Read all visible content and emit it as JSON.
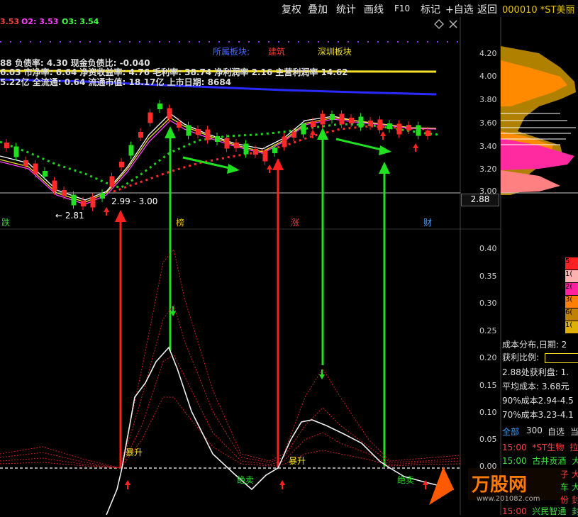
{
  "toolbar": {
    "items": [
      "复权",
      "叠加",
      "统计",
      "画线",
      "F10",
      "标记",
      "+自选",
      "返回"
    ],
    "stock_title": "000010 *ST美丽",
    "icons": [
      "diamond-icon",
      "close-icon"
    ]
  },
  "ma_line": {
    "items": [
      {
        "text": "3.53",
        "color": "#ff4040"
      },
      {
        "text": "O2: 3.53",
        "color": "#ff40ff"
      },
      {
        "text": "O3: 3.54",
        "color": "#40ff40"
      }
    ]
  },
  "block_row": {
    "label": "所属板块:",
    "industry": "建筑",
    "region": "深圳板块"
  },
  "info_lines": [
    {
      "text": "88 负债率: 4.30 现金负债比: -0.040",
      "color": "#ff3a3a"
    },
    {
      "text": "6.03 市净率: 6.64 净资收益率: 4.76 毛利率: 38.74 净利润率 2.16 主营利润率 14.62",
      "color": "#f5e12a"
    },
    {
      "text": "5.22亿 全流通: 0.64 流通市值: 18.17亿 上市日期: 8684",
      "color": "#ff3ae0"
    }
  ],
  "price_axis": [
    "4.20",
    "4.00",
    "3.80",
    "3.60",
    "3.40",
    "3.20",
    "3.00"
  ],
  "price_tag": "2.88",
  "annotations": {
    "low": "← 2.81",
    "range": "2.99 - 3.00"
  },
  "event_tags": [
    {
      "text": "跌",
      "color": "#3cd23c"
    },
    {
      "text": "榜",
      "color": "#e0c200"
    },
    {
      "text": "涨",
      "color": "#ff3030"
    },
    {
      "text": "财",
      "color": "#4aa0ff"
    }
  ],
  "indicator_axis": [
    "0.40",
    "0.35",
    "0.30",
    "0.25",
    "0.20",
    "0.15",
    "0.10",
    "0.05",
    "0.00"
  ],
  "indicator_labels": {
    "rise": "暴升",
    "rise2": "暴升",
    "sell": "绝卖",
    "sell2": "绝卖"
  },
  "side_panel": {
    "title": "成本分布,日期: 2",
    "profit_label": "获利比例:",
    "profit_at": "2.88处获利盘: 1.",
    "avg_cost": "平均成本: 3.68元",
    "cost90": "90%成本2.94-4.5",
    "cost70": "70%成本3.23-4.1",
    "tabs": [
      "全部",
      "300",
      "自选",
      "当"
    ],
    "legend": [
      {
        "text": "5",
        "color": "#ff2020"
      },
      {
        "text": "1(",
        "color": "#ffb0b0"
      },
      {
        "text": "2(",
        "color": "#ff20a0"
      },
      {
        "text": "3(",
        "color": "#ff8000"
      },
      {
        "text": "6(",
        "color": "#c08000"
      },
      {
        "text": "1(",
        "color": "#e0b000"
      }
    ]
  },
  "watchlist": [
    {
      "time": "15:00",
      "name": "*ST生物",
      "suffix": "拉",
      "color": "#ff4040"
    },
    {
      "time": "15:00",
      "name": "古井贡酒",
      "suffix": "大",
      "color": "#40e040"
    },
    {
      "time": "",
      "name": "子",
      "suffix": "大",
      "color": "#ff4040"
    },
    {
      "time": "",
      "name": "车",
      "suffix": "大",
      "color": "#40e040"
    },
    {
      "time": "",
      "name": "份",
      "suffix": "封",
      "color": "#ff4040"
    },
    {
      "time": "15:00",
      "name": "兴民智通",
      "suffix": "封",
      "color": "#40e040"
    }
  ],
  "watermark": {
    "text": "万股网",
    "sub": "www.201082.com"
  },
  "colors": {
    "up": "#ff3030",
    "down": "#20e020",
    "accent": "#f5e12a"
  }
}
